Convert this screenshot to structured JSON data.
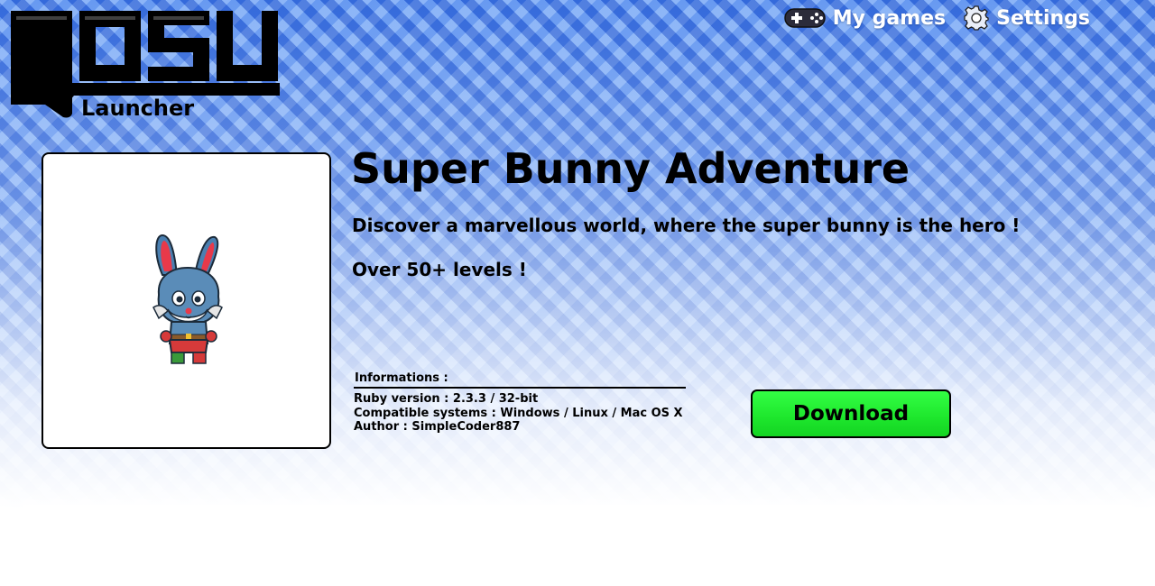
{
  "app": {
    "logo_text": "gosu",
    "logo_sub": "Launcher"
  },
  "nav": {
    "my_games": {
      "label": "My games",
      "icon": "gamepad-icon"
    },
    "settings": {
      "label": "Settings",
      "icon": "gear-icon"
    }
  },
  "game": {
    "title": "Super Bunny Adventure",
    "description": "Discover a marvellous world, where the super bunny is the hero !",
    "highlight": "Over 50+ levels !",
    "cover_icon": "bunny-icon"
  },
  "info": {
    "heading": "Informations :",
    "ruby_version": "Ruby version : 2.3.3 / 32-bit",
    "systems": "Compatible systems : Windows / Linux / Mac OS X",
    "author": "Author : SimpleCoder887"
  },
  "actions": {
    "download_label": "Download"
  },
  "colors": {
    "accent_green": "#1de62c",
    "background_blue": "#4a82e6"
  }
}
